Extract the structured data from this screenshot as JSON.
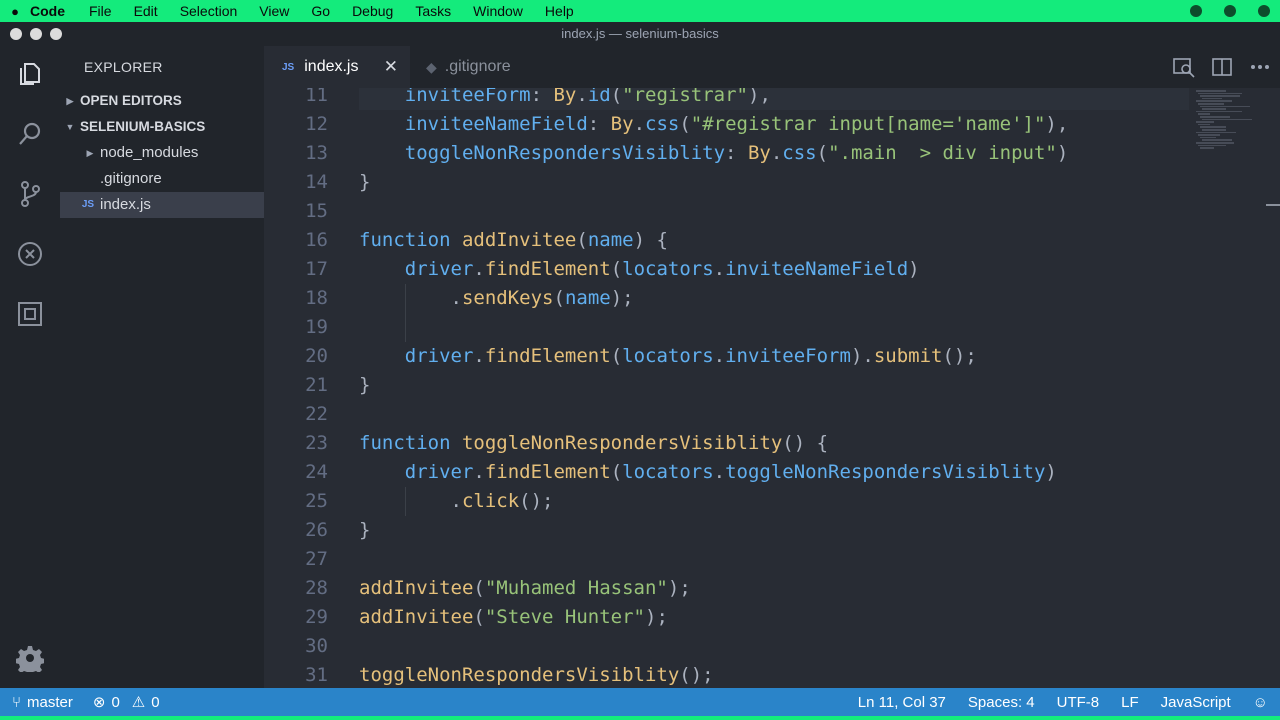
{
  "menubar": {
    "app": "Code",
    "items": [
      "File",
      "Edit",
      "Selection",
      "View",
      "Go",
      "Debug",
      "Tasks",
      "Window",
      "Help"
    ]
  },
  "window": {
    "title": "index.js — selenium-basics"
  },
  "sidebar": {
    "title": "EXPLORER",
    "open_editors": "OPEN EDITORS",
    "project": "SELENIUM-BASICS",
    "items": [
      {
        "label": "node_modules",
        "type": "folder"
      },
      {
        "label": ".gitignore",
        "type": "file"
      },
      {
        "label": "index.js",
        "type": "js",
        "selected": true
      }
    ]
  },
  "tabs": [
    {
      "label": "index.js",
      "badge": "JS",
      "active": true
    },
    {
      "label": ".gitignore",
      "active": false
    }
  ],
  "editor": {
    "lines": [
      {
        "n": "11",
        "indent": 1,
        "tokens": [
          [
            "prop",
            "inviteeForm"
          ],
          [
            "pm",
            ": "
          ],
          [
            "fn",
            "By"
          ],
          [
            "pm",
            "."
          ],
          [
            "prop",
            "id"
          ],
          [
            "pm",
            "("
          ],
          [
            "str",
            "\"registrar\""
          ],
          [
            "pm",
            "),"
          ]
        ]
      },
      {
        "n": "12",
        "indent": 1,
        "tokens": [
          [
            "prop",
            "inviteeNameField"
          ],
          [
            "pm",
            ": "
          ],
          [
            "fn",
            "By"
          ],
          [
            "pm",
            "."
          ],
          [
            "prop",
            "css"
          ],
          [
            "pm",
            "("
          ],
          [
            "str",
            "\"#registrar input[name='name']\""
          ],
          [
            "pm",
            "),"
          ]
        ]
      },
      {
        "n": "13",
        "indent": 1,
        "tokens": [
          [
            "prop",
            "toggleNonRespondersVisiblity"
          ],
          [
            "pm",
            ": "
          ],
          [
            "fn",
            "By"
          ],
          [
            "pm",
            "."
          ],
          [
            "prop",
            "css"
          ],
          [
            "pm",
            "("
          ],
          [
            "str",
            "\".main  > div input\""
          ],
          [
            "pm",
            ")"
          ]
        ]
      },
      {
        "n": "14",
        "indent": 0,
        "tokens": [
          [
            "pm",
            "}"
          ]
        ]
      },
      {
        "n": "15",
        "indent": 0,
        "tokens": []
      },
      {
        "n": "16",
        "indent": 0,
        "tokens": [
          [
            "kw",
            "function"
          ],
          [
            "pm",
            " "
          ],
          [
            "fn",
            "addInvitee"
          ],
          [
            "pm",
            "("
          ],
          [
            "prop",
            "name"
          ],
          [
            "pm",
            ") {"
          ]
        ]
      },
      {
        "n": "17",
        "indent": 1,
        "tokens": [
          [
            "prop",
            "driver"
          ],
          [
            "pm",
            "."
          ],
          [
            "fn",
            "findElement"
          ],
          [
            "pm",
            "("
          ],
          [
            "prop",
            "locators"
          ],
          [
            "pm",
            "."
          ],
          [
            "prop",
            "inviteeNameField"
          ],
          [
            "pm",
            ")"
          ]
        ]
      },
      {
        "n": "18",
        "indent": 2,
        "tokens": [
          [
            "pm",
            "."
          ],
          [
            "fn",
            "sendKeys"
          ],
          [
            "pm",
            "("
          ],
          [
            "prop",
            "name"
          ],
          [
            "pm",
            ");"
          ]
        ]
      },
      {
        "n": "19",
        "indent": 0,
        "tokens": []
      },
      {
        "n": "20",
        "indent": 1,
        "tokens": [
          [
            "prop",
            "driver"
          ],
          [
            "pm",
            "."
          ],
          [
            "fn",
            "findElement"
          ],
          [
            "pm",
            "("
          ],
          [
            "prop",
            "locators"
          ],
          [
            "pm",
            "."
          ],
          [
            "prop",
            "inviteeForm"
          ],
          [
            "pm",
            ")."
          ],
          [
            "fn",
            "submit"
          ],
          [
            "pm",
            "();"
          ]
        ]
      },
      {
        "n": "21",
        "indent": 0,
        "tokens": [
          [
            "pm",
            "}"
          ]
        ]
      },
      {
        "n": "22",
        "indent": 0,
        "tokens": []
      },
      {
        "n": "23",
        "indent": 0,
        "tokens": [
          [
            "kw",
            "function"
          ],
          [
            "pm",
            " "
          ],
          [
            "fn",
            "toggleNonRespondersVisiblity"
          ],
          [
            "pm",
            "() {"
          ]
        ]
      },
      {
        "n": "24",
        "indent": 1,
        "tokens": [
          [
            "prop",
            "driver"
          ],
          [
            "pm",
            "."
          ],
          [
            "fn",
            "findElement"
          ],
          [
            "pm",
            "("
          ],
          [
            "prop",
            "locators"
          ],
          [
            "pm",
            "."
          ],
          [
            "prop",
            "toggleNonRespondersVisiblity"
          ],
          [
            "pm",
            ")"
          ]
        ]
      },
      {
        "n": "25",
        "indent": 2,
        "tokens": [
          [
            "pm",
            "."
          ],
          [
            "fn",
            "click"
          ],
          [
            "pm",
            "();"
          ]
        ]
      },
      {
        "n": "26",
        "indent": 0,
        "tokens": [
          [
            "pm",
            "}"
          ]
        ]
      },
      {
        "n": "27",
        "indent": 0,
        "tokens": []
      },
      {
        "n": "28",
        "indent": 0,
        "tokens": [
          [
            "fn",
            "addInvitee"
          ],
          [
            "pm",
            "("
          ],
          [
            "str",
            "\"Muhamed Hassan\""
          ],
          [
            "pm",
            ");"
          ]
        ]
      },
      {
        "n": "29",
        "indent": 0,
        "tokens": [
          [
            "fn",
            "addInvitee"
          ],
          [
            "pm",
            "("
          ],
          [
            "str",
            "\"Steve Hunter\""
          ],
          [
            "pm",
            ");"
          ]
        ]
      },
      {
        "n": "30",
        "indent": 0,
        "tokens": []
      },
      {
        "n": "31",
        "indent": 0,
        "tokens": [
          [
            "fn",
            "toggleNonRespondersVisiblity"
          ],
          [
            "pm",
            "();"
          ]
        ]
      }
    ]
  },
  "statusbar": {
    "branch": "master",
    "errors": "0",
    "warnings": "0",
    "position": "Ln 11, Col 37",
    "spaces": "Spaces: 4",
    "encoding": "UTF-8",
    "eol": "LF",
    "language": "JavaScript"
  },
  "colors": {
    "menubar": "#14eb7c",
    "statusbar": "#2a84c9",
    "editor_bg": "#282c34",
    "sidebar_bg": "#21252b"
  }
}
